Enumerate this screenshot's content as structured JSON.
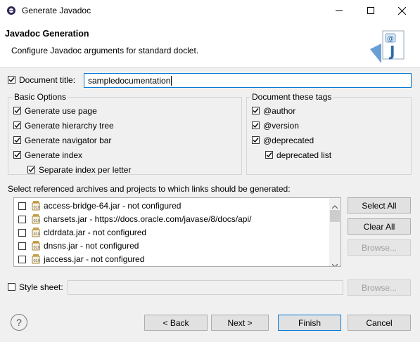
{
  "window": {
    "title": "Generate Javadoc"
  },
  "header": {
    "title": "Javadoc Generation",
    "description": "Configure Javadoc arguments for standard doclet."
  },
  "doc_title": {
    "label": "Document title:",
    "value": "sampledocumentation",
    "checked": true
  },
  "basic_options": {
    "title": "Basic Options",
    "items": [
      {
        "label": "Generate use page",
        "checked": true
      },
      {
        "label": "Generate hierarchy tree",
        "checked": true
      },
      {
        "label": "Generate navigator bar",
        "checked": true
      },
      {
        "label": "Generate index",
        "checked": true
      },
      {
        "label": "Separate index per letter",
        "checked": true
      }
    ]
  },
  "tags": {
    "title": "Document these tags",
    "items": [
      {
        "label": "@author",
        "checked": true
      },
      {
        "label": "@version",
        "checked": true
      },
      {
        "label": "@deprecated",
        "checked": true
      },
      {
        "label": "deprecated list",
        "checked": true
      }
    ]
  },
  "links": {
    "label": "Select referenced archives and projects to which links should be generated:",
    "items": [
      {
        "label": "access-bridge-64.jar - not configured",
        "checked": false
      },
      {
        "label": "charsets.jar - https://docs.oracle.com/javase/8/docs/api/",
        "checked": false
      },
      {
        "label": "cldrdata.jar - not configured",
        "checked": false
      },
      {
        "label": "dnsns.jar - not configured",
        "checked": false
      },
      {
        "label": "jaccess.jar - not configured",
        "checked": false
      }
    ],
    "select_all": "Select All",
    "clear_all": "Clear All",
    "browse": "Browse..."
  },
  "style_sheet": {
    "label": "Style sheet:",
    "value": "",
    "checked": false,
    "browse": "Browse..."
  },
  "footer": {
    "back": "< Back",
    "next": "Next >",
    "finish": "Finish",
    "cancel": "Cancel",
    "help_icon": "?"
  },
  "colors": {
    "accent": "#0078d7",
    "border": "#adadad",
    "background": "#f0f0f0"
  }
}
